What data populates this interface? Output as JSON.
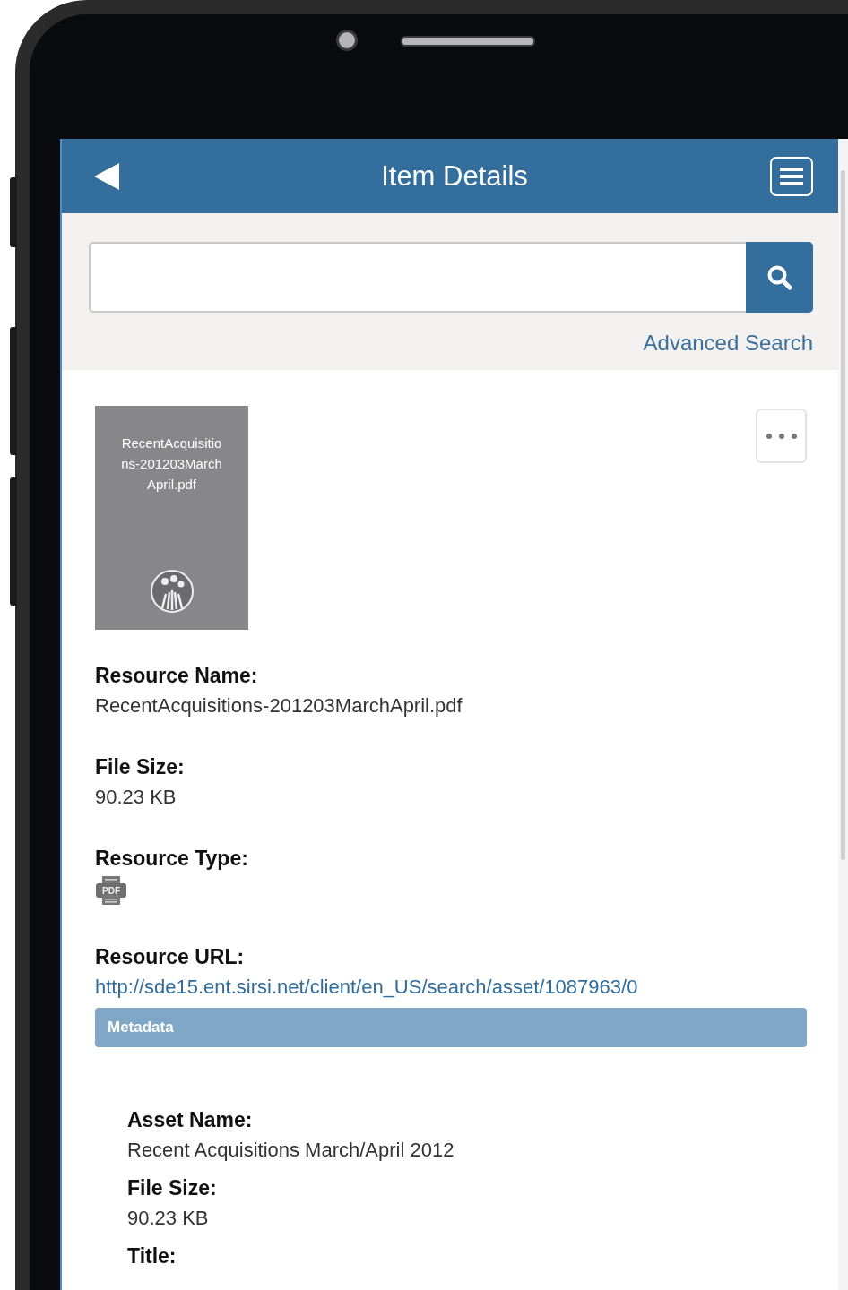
{
  "header": {
    "title": "Item Details"
  },
  "search": {
    "link": "Advanced Search"
  },
  "thumbnail": {
    "caption": "RecentAcquisitions-201203MarchApril.pdf"
  },
  "fields": [
    {
      "kind": "text",
      "label": "Resource Name:",
      "value": "RecentAcquisitions-201203MarchApril.pdf"
    },
    {
      "kind": "text",
      "label": "File Size:",
      "value": "90.23 KB"
    },
    {
      "kind": "icon",
      "label": "Resource Type:",
      "value": "PDF"
    },
    {
      "kind": "link",
      "label": "Resource URL:",
      "value": "http://sde15.ent.sirsi.net/client/en_US/search/asset/1087963/0"
    }
  ],
  "metadata": {
    "title": "Metadata",
    "fields": [
      {
        "label": "Asset Name:",
        "value": "Recent Acquisitions March/April 2012"
      },
      {
        "label": "File Size:",
        "value": "90.23 KB"
      },
      {
        "label": "Title:"
      }
    ]
  }
}
